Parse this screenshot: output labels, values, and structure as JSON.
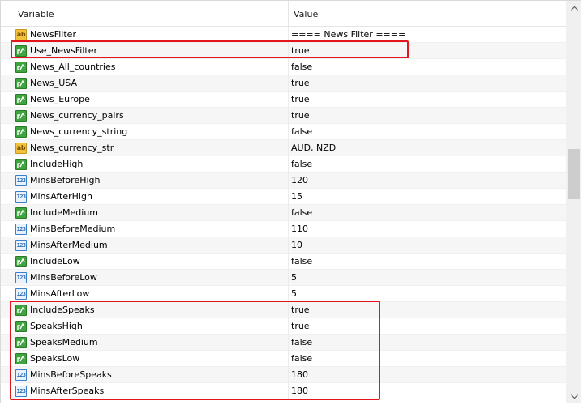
{
  "header": {
    "variable_label": "Variable",
    "value_label": "Value"
  },
  "rows": [
    {
      "type": "str",
      "icon": "string-type-icon",
      "name": "NewsFilter",
      "value": "==== News Filter ===="
    },
    {
      "type": "bool",
      "icon": "bool-type-icon",
      "name": "Use_NewsFilter",
      "value": "true"
    },
    {
      "type": "bool",
      "icon": "bool-type-icon",
      "name": "News_All_countries",
      "value": "false"
    },
    {
      "type": "bool",
      "icon": "bool-type-icon",
      "name": "News_USA",
      "value": "true"
    },
    {
      "type": "bool",
      "icon": "bool-type-icon",
      "name": "News_Europe",
      "value": "true"
    },
    {
      "type": "bool",
      "icon": "bool-type-icon",
      "name": "News_currency_pairs",
      "value": "true"
    },
    {
      "type": "bool",
      "icon": "bool-type-icon",
      "name": "News_currency_string",
      "value": "false"
    },
    {
      "type": "str",
      "icon": "string-type-icon",
      "name": "News_currency_str",
      "value": "AUD, NZD"
    },
    {
      "type": "bool",
      "icon": "bool-type-icon",
      "name": "IncludeHigh",
      "value": "false"
    },
    {
      "type": "int",
      "icon": "integer-type-icon",
      "name": "MinsBeforeHigh",
      "value": "120"
    },
    {
      "type": "int",
      "icon": "integer-type-icon",
      "name": "MinsAfterHigh",
      "value": "15"
    },
    {
      "type": "bool",
      "icon": "bool-type-icon",
      "name": "IncludeMedium",
      "value": "false"
    },
    {
      "type": "int",
      "icon": "integer-type-icon",
      "name": "MinsBeforeMedium",
      "value": "110"
    },
    {
      "type": "int",
      "icon": "integer-type-icon",
      "name": "MinsAfterMedium",
      "value": "10"
    },
    {
      "type": "bool",
      "icon": "bool-type-icon",
      "name": "IncludeLow",
      "value": "false"
    },
    {
      "type": "int",
      "icon": "integer-type-icon",
      "name": "MinsBeforeLow",
      "value": "5"
    },
    {
      "type": "int",
      "icon": "integer-type-icon",
      "name": "MinsAfterLow",
      "value": "5"
    },
    {
      "type": "bool",
      "icon": "bool-type-icon",
      "name": "IncludeSpeaks",
      "value": "true"
    },
    {
      "type": "bool",
      "icon": "bool-type-icon",
      "name": "SpeaksHigh",
      "value": "true"
    },
    {
      "type": "bool",
      "icon": "bool-type-icon",
      "name": "SpeaksMedium",
      "value": "false"
    },
    {
      "type": "bool",
      "icon": "bool-type-icon",
      "name": "SpeaksLow",
      "value": "false"
    },
    {
      "type": "int",
      "icon": "integer-type-icon",
      "name": "MinsBeforeSpeaks",
      "value": "180"
    },
    {
      "type": "int",
      "icon": "integer-type-icon",
      "name": "MinsAfterSpeaks",
      "value": "180"
    }
  ],
  "icon_text": {
    "string": "ab",
    "integer": "123"
  },
  "colors": {
    "highlight": "#e3161b",
    "bool_icon": "#3ea43e",
    "string_icon": "#f2c23a",
    "integer_icon": "#3a7fc8"
  }
}
